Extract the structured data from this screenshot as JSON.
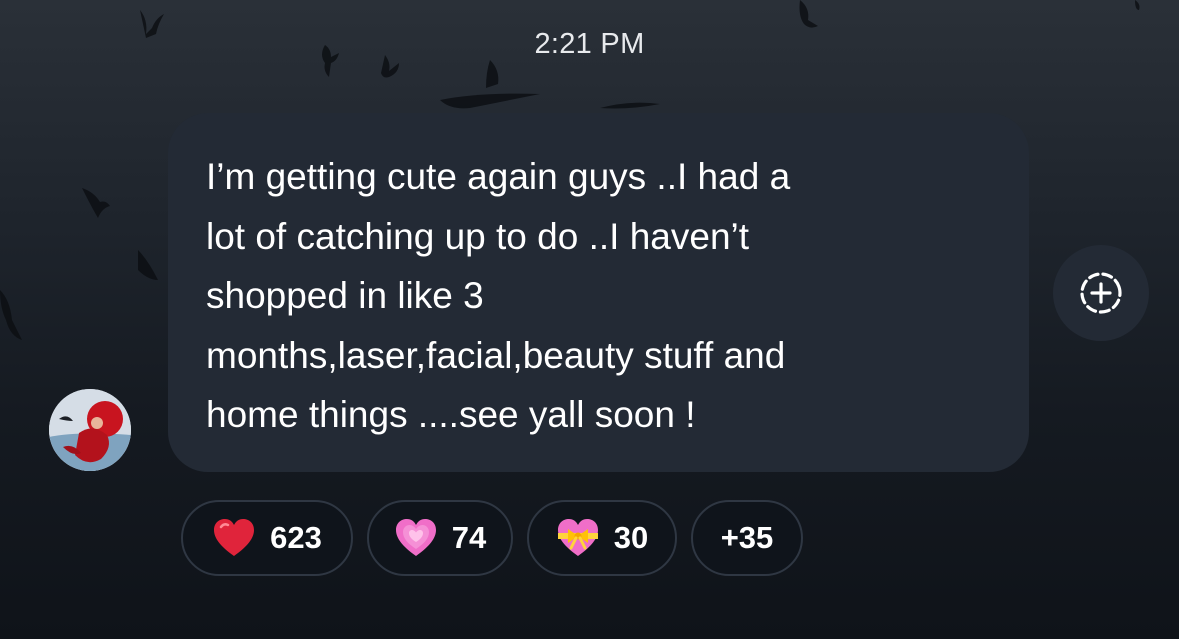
{
  "timestamp": "2:21 PM",
  "message": {
    "lines": [
      "I’m getting cute again guys ..I had a",
      "lot of catching up to do ..I haven’t",
      "shopped in like 3",
      "months,laser,facial,beauty stuff and",
      "home things ....see yall soon !"
    ]
  },
  "reactions": [
    {
      "icon": "red-heart-icon",
      "count": "623"
    },
    {
      "icon": "growing-heart-icon",
      "count": "74"
    },
    {
      "icon": "heart-with-ribbon-icon",
      "count": "30"
    },
    {
      "icon": "",
      "count": "+35"
    }
  ],
  "colors": {
    "bubble": "#232a35",
    "background_top": "#2a3038",
    "background_bottom": "#0f1319",
    "pill_border": "#2f3743",
    "red_heart": "#e0243b",
    "pink_heart": "#f06ec8",
    "ribbon": "#ffd43b"
  }
}
